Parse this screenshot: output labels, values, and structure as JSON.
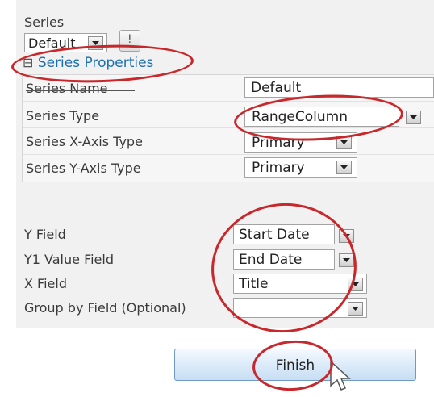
{
  "series_section": {
    "label": "Series",
    "selected_series": "Default",
    "add_button_label": "!"
  },
  "series_properties": {
    "toggle_symbol": "⊟",
    "header": "Series Properties",
    "rows": [
      {
        "label": "Series Name",
        "value": "Default"
      },
      {
        "label": "Series Type",
        "value": "RangeColumn"
      },
      {
        "label": "Series X-Axis Type",
        "value": "Primary"
      },
      {
        "label": "Series Y-Axis Type",
        "value": "Primary"
      }
    ]
  },
  "fields": [
    {
      "label": "Y Field",
      "value": "Start Date"
    },
    {
      "label": "Y1 Value Field",
      "value": "End Date"
    },
    {
      "label": "X Field",
      "value": "Title"
    },
    {
      "label": "Group by Field (Optional)",
      "value": ""
    }
  ],
  "finish_button": {
    "label": "Finish"
  },
  "colors": {
    "annotation": "#c8282b",
    "link": "#1a6fb1",
    "panel": "#f1f1f1"
  }
}
